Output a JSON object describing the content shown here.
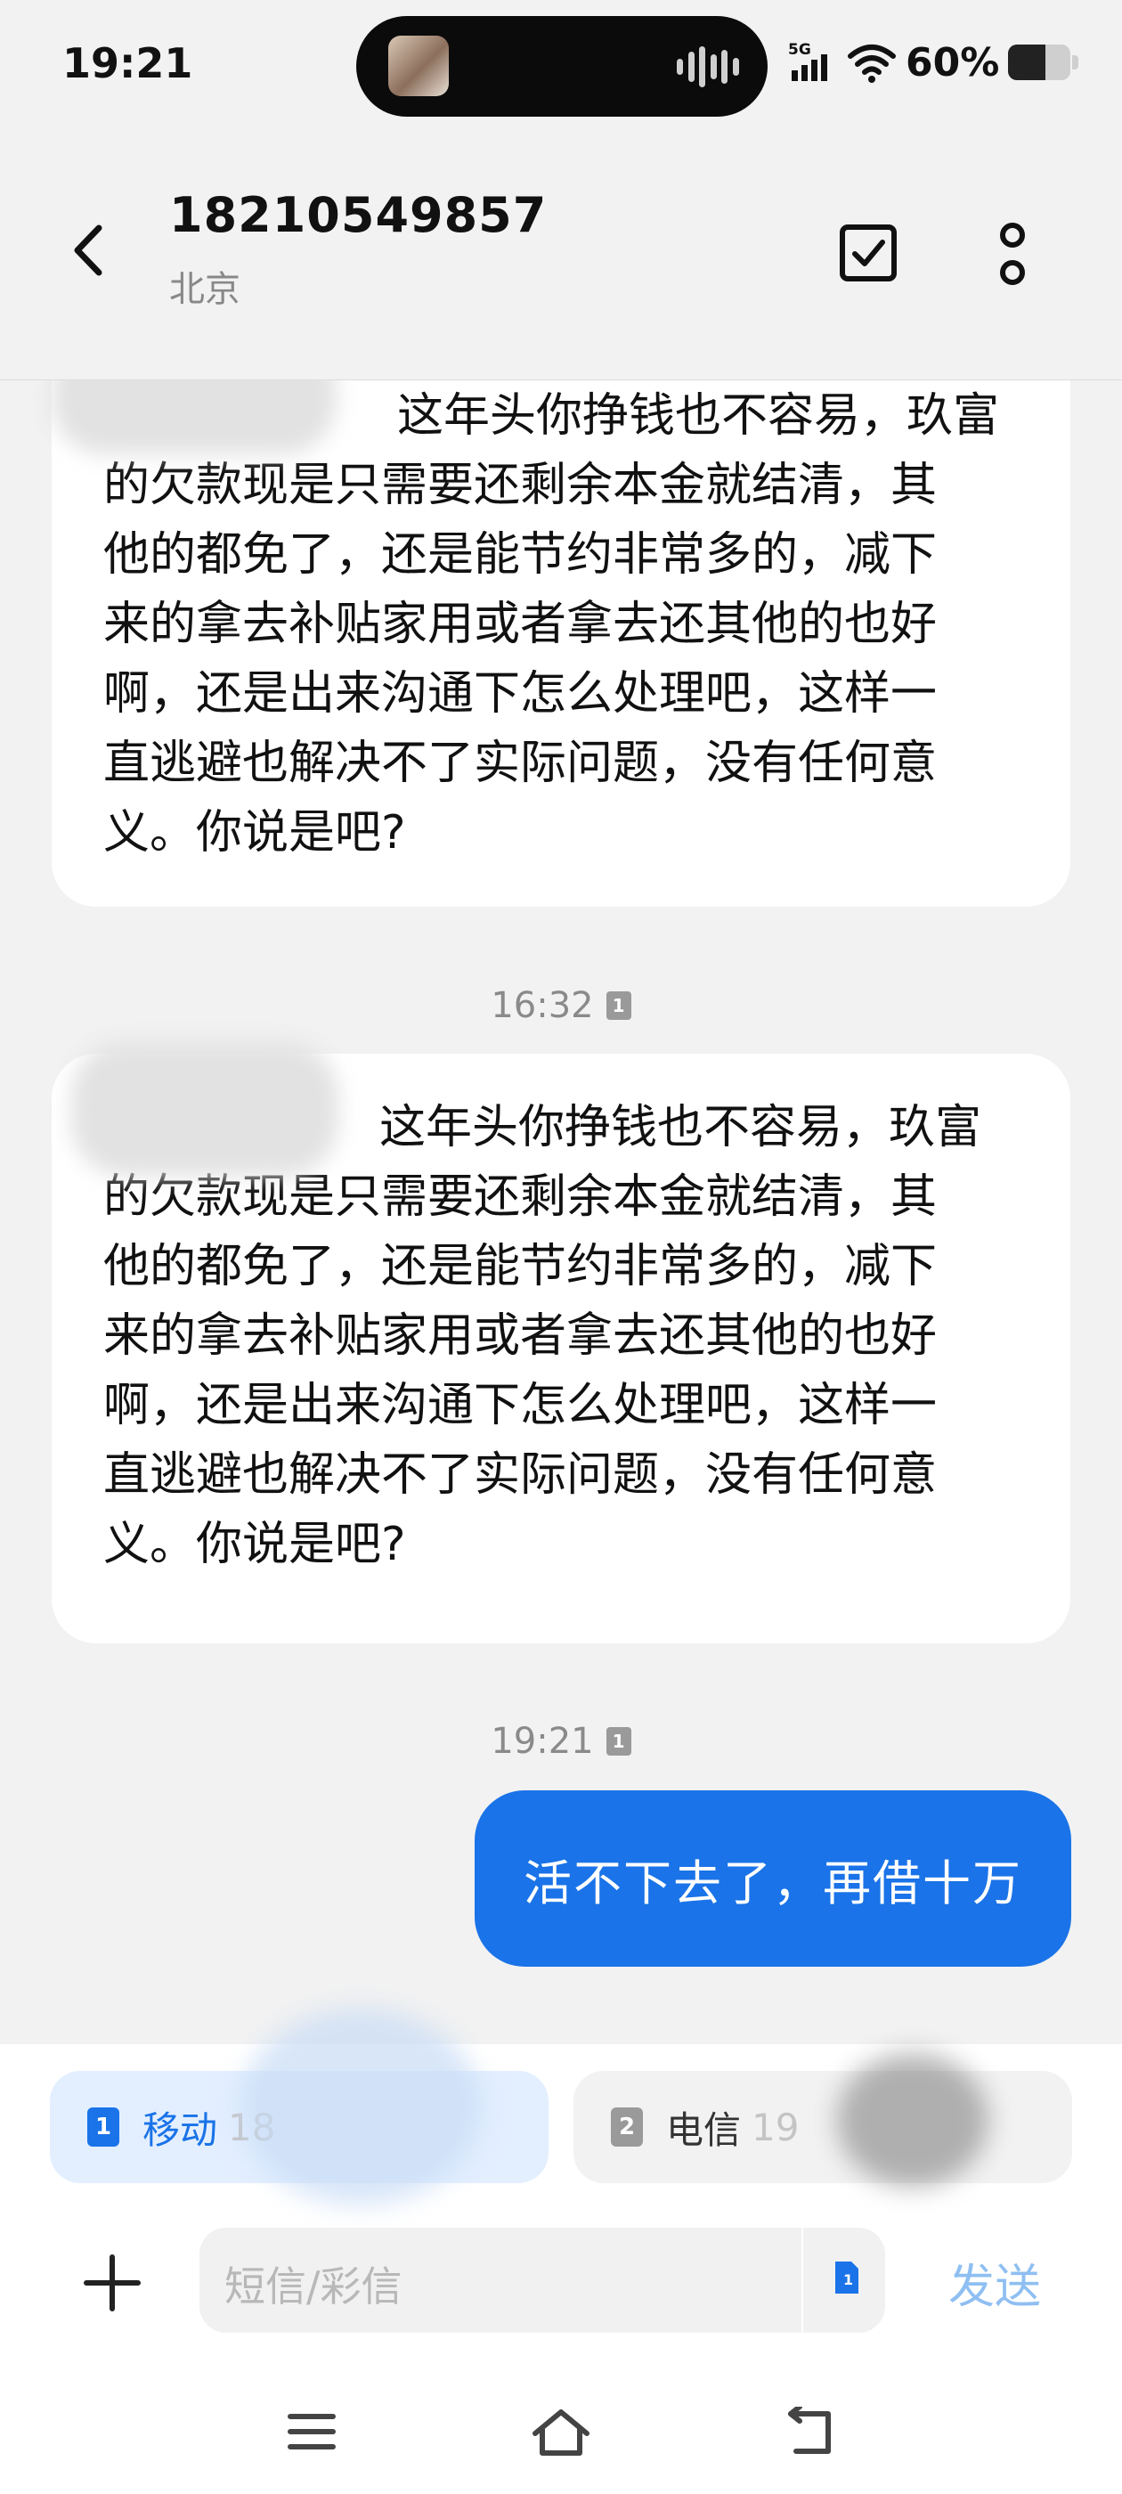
{
  "status_bar": {
    "time": "19:21",
    "network": "5G",
    "battery_text": "60%",
    "battery_level": 0.6
  },
  "header": {
    "contact_number": "18210549857",
    "contact_location": "北京",
    "icons": [
      "back-arrow-icon",
      "select-checkbox-icon",
      "more-options-icon"
    ]
  },
  "messages": [
    {
      "direction": "incoming",
      "text": "这年头你挣钱也不容易，玖富\n的欠款现是只需要还剩余本金就结清，其\n他的都免了，还是能节约非常多的，减下\n来的拿去补贴家用或者拿去还其他的也好\n啊，还是出来沟通下怎么处理吧，这样一\n直逃避也解决不了实际问题，没有任何意\n义。你说是吧?"
    },
    {
      "direction": "incoming",
      "timestamp": "16:32",
      "text": "这年头你挣钱也不容易，玖富\n的欠款现是只需要还剩余本金就结清，其\n他的都免了，还是能节约非常多的，减下\n来的拿去补贴家用或者拿去还其他的也好\n啊，还是出来沟通下怎么处理吧，这样一\n直逃避也解决不了实际问题，没有任何意\n义。你说是吧?"
    },
    {
      "direction": "outgoing",
      "timestamp": "19:21",
      "text": "活不下去了，再借十万"
    }
  ],
  "composer": {
    "sim1": {
      "badge": "1",
      "label": "移动",
      "number_partial": "18"
    },
    "sim2": {
      "badge": "2",
      "label": "电信",
      "number_partial": "19"
    },
    "placeholder": "短信/彩信",
    "send_label": "发送"
  },
  "nav": {
    "buttons": [
      "menu-icon",
      "home-icon",
      "back-icon"
    ]
  }
}
